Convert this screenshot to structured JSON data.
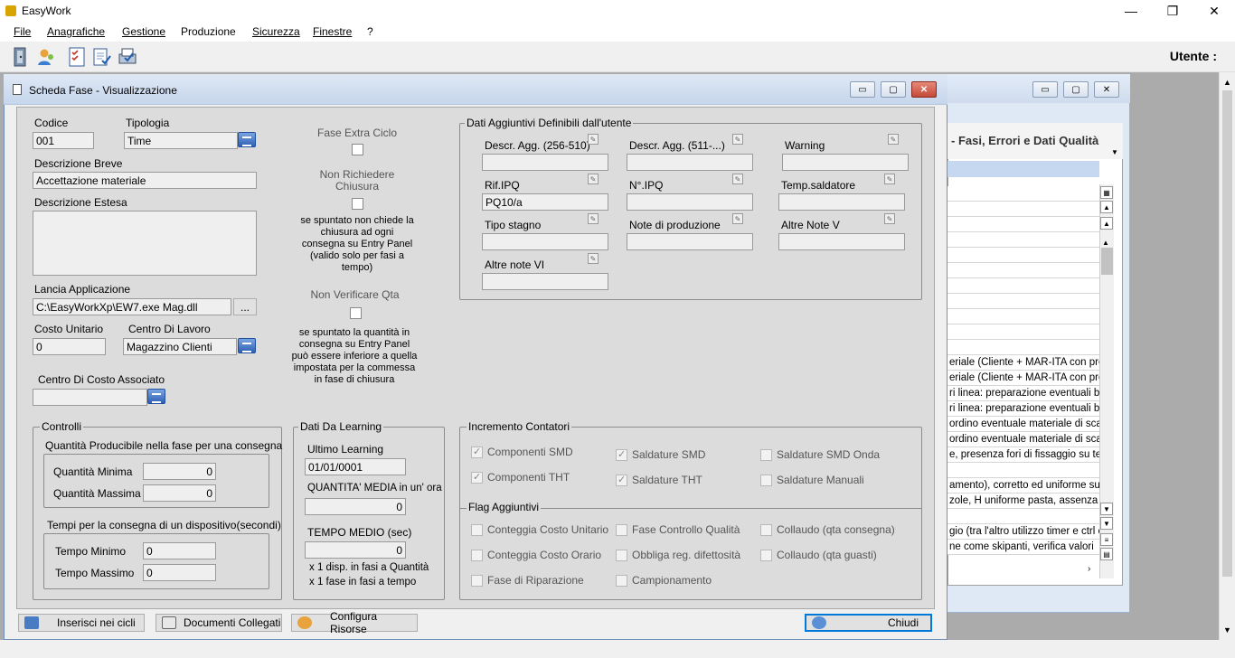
{
  "app": {
    "title": "EasyWork",
    "minimize": "—",
    "maximize": "❐",
    "close": "✕"
  },
  "menu": [
    "File",
    "Anagrafiche",
    "Gestione",
    "Produzione",
    "Sicurezza",
    "Finestre",
    "?"
  ],
  "toolbar": {
    "utente_label": "Utente :"
  },
  "bg_window": {
    "header": "- Fasi, Errori e Dati Qualità",
    "rows": [
      "",
      "",
      "",
      "",
      "",
      "",
      "",
      "",
      "",
      "",
      "",
      "eriale (Cliente + MAR-ITA con prel",
      "eriale (Cliente + MAR-ITA con prel",
      "ri linea: preparazione eventuali bl",
      "ri linea: preparazione eventuali bl",
      "ordino eventuale materiale di sca",
      "ordino eventuale materiale di sca",
      "e, presenza fori di fissaggio su tel",
      "",
      "amento), corretto ed uniforme supp",
      "zole, H uniforme pasta, assenza r",
      "",
      "gio (tra l'altro utilizzo timer e ctrl c",
      "ne come skipanti, verifica valori"
    ]
  },
  "dialog": {
    "title": "Scheda Fase - Visualizzazione",
    "codice": {
      "label": "Codice",
      "value": "001"
    },
    "tipologia": {
      "label": "Tipologia",
      "value": "Time"
    },
    "descr_breve": {
      "label": "Descrizione Breve",
      "value": "Accettazione materiale"
    },
    "descr_estesa": {
      "label": "Descrizione Estesa",
      "value": ""
    },
    "lancia": {
      "label": "Lancia Applicazione",
      "value": "C:\\EasyWorkXp\\EW7.exe Mag.dll",
      "browse": "..."
    },
    "costo_unitario": {
      "label": "Costo Unitario",
      "value": "0"
    },
    "centro_lavoro": {
      "label": "Centro Di Lavoro",
      "value": "Magazzino Clienti"
    },
    "centro_costo": {
      "label": "Centro Di Costo Associato",
      "value": ""
    },
    "fase_extra": {
      "label": "Fase Extra Ciclo",
      "checked": false
    },
    "non_richiedere": {
      "label": "Non Richiedere Chiusura",
      "checked": false,
      "help": "se spuntato non chiede la chiusura ad ogni consegna su Entry Panel (valido solo per fasi a tempo)"
    },
    "non_verificare": {
      "label": "Non Verificare Qta",
      "checked": false,
      "help": "se spuntato la quantità in consegna su Entry Panel può essere inferiore a quella impostata per la commessa in fase di chiusura"
    },
    "dati_agg": {
      "title": "Dati Aggiuntivi Definibili dall'utente",
      "fields": [
        {
          "label": "Descr. Agg. (256-510)",
          "value": ""
        },
        {
          "label": "Descr. Agg. (511-...)",
          "value": ""
        },
        {
          "label": "Warning",
          "value": ""
        },
        {
          "label": "Rif.IPQ",
          "value": "PQ10/a"
        },
        {
          "label": "N°.IPQ",
          "value": ""
        },
        {
          "label": "Temp.saldatore",
          "value": ""
        },
        {
          "label": "Tipo stagno",
          "value": ""
        },
        {
          "label": "Note di produzione",
          "value": ""
        },
        {
          "label": "Altre Note V",
          "value": ""
        },
        {
          "label": "Altre note VI",
          "value": ""
        }
      ]
    },
    "controlli": {
      "title": "Controlli",
      "qta_title": "Quantità Producibile nella fase per una consegna",
      "qta_min": {
        "label": "Quantità Minima",
        "value": "0"
      },
      "qta_max": {
        "label": "Quantità Massima",
        "value": "0"
      },
      "tempi_title": "Tempi per la consegna di un dispositivo(secondi)",
      "tempo_min": {
        "label": "Tempo Minimo",
        "value": "0"
      },
      "tempo_max": {
        "label": "Tempo Massimo",
        "value": "0"
      }
    },
    "learning": {
      "title": "Dati Da Learning",
      "ultimo": {
        "label": "Ultimo Learning",
        "value": "01/01/0001"
      },
      "qta_media": {
        "label": "QUANTITA' MEDIA in un' ora",
        "value": "0"
      },
      "tempo_medio": {
        "label": "TEMPO MEDIO (sec)",
        "value": "0"
      },
      "note1": "x 1 disp. in fasi a Quantità",
      "note2": "x 1 fase in fasi a tempo"
    },
    "contatori": {
      "title": "Incremento Contatori",
      "items": [
        {
          "label": "Componenti SMD",
          "checked": true
        },
        {
          "label": "Saldature SMD",
          "checked": true
        },
        {
          "label": "Saldature SMD Onda",
          "checked": false
        },
        {
          "label": "Componenti THT",
          "checked": true
        },
        {
          "label": "Saldature THT",
          "checked": true
        },
        {
          "label": "Saldature Manuali",
          "checked": false
        }
      ]
    },
    "flag": {
      "title": "Flag Aggiuntivi",
      "items": [
        {
          "label": "Conteggia Costo Unitario",
          "checked": false
        },
        {
          "label": "Fase Controllo Qualità",
          "checked": false
        },
        {
          "label": "Collaudo (qta consegna)",
          "checked": false
        },
        {
          "label": "Conteggia Costo Orario",
          "checked": false
        },
        {
          "label": "Obbliga reg. difettosità",
          "checked": false
        },
        {
          "label": "Collaudo (qta guasti)",
          "checked": false
        },
        {
          "label": "Fase di Riparazione",
          "checked": false
        },
        {
          "label": "Campionamento",
          "checked": false
        }
      ]
    },
    "buttons": {
      "inserisci": "Inserisci nei cicli",
      "documenti": "Documenti Collegati",
      "configura": "Configura Risorse",
      "chiudi": "Chiudi"
    }
  }
}
